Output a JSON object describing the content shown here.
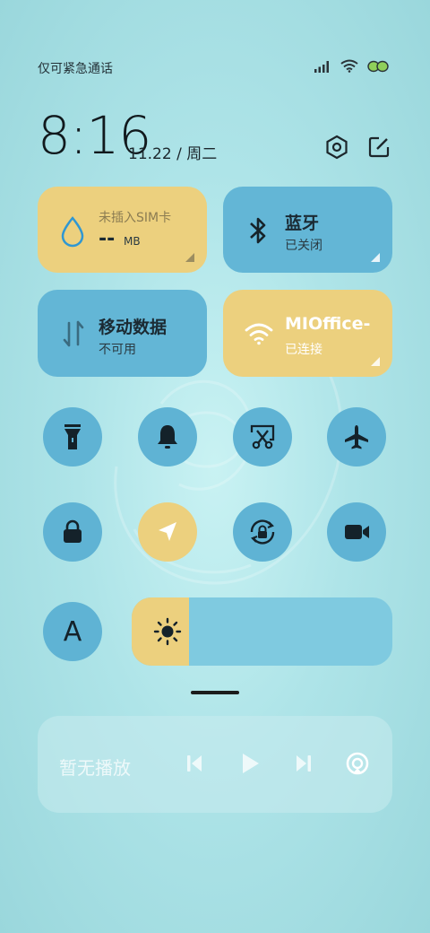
{
  "status_bar": {
    "carrier_text": "仅可紧急通话",
    "icons": [
      "signal-icon",
      "wifi-icon",
      "battery-icon"
    ]
  },
  "header": {
    "time": "8:16",
    "date": "11.22 / 周二",
    "icons": [
      "settings-hexagon-icon",
      "edit-icon"
    ]
  },
  "tiles": {
    "data_usage": {
      "title": "未插入SIM卡",
      "value": "--",
      "unit": "MB",
      "icon": "water-drop-icon"
    },
    "bluetooth": {
      "title": "蓝牙",
      "status": "已关闭",
      "icon": "bluetooth-icon"
    },
    "mobile_data": {
      "title": "移动数据",
      "status": "不可用",
      "icon": "data-arrows-icon"
    },
    "wifi": {
      "title": "MIOffice-",
      "status": "已连接",
      "icon": "wifi-icon"
    }
  },
  "toggles_row1": [
    "flashlight-icon",
    "bell-icon",
    "screenshot-icon",
    "airplane-icon"
  ],
  "toggles_row2": [
    "lock-icon",
    "location-icon",
    "rotation-lock-icon",
    "video-camera-icon"
  ],
  "auto_brightness_label": "A",
  "brightness_level": 0.22,
  "colors": {
    "accent_yellow": "#ecd07e",
    "tile_blue": "#63b6d6",
    "background": "#aee4e8"
  },
  "media": {
    "label": "暂无播放",
    "controls": [
      "previous-icon",
      "play-icon",
      "next-icon",
      "cast-icon"
    ]
  }
}
